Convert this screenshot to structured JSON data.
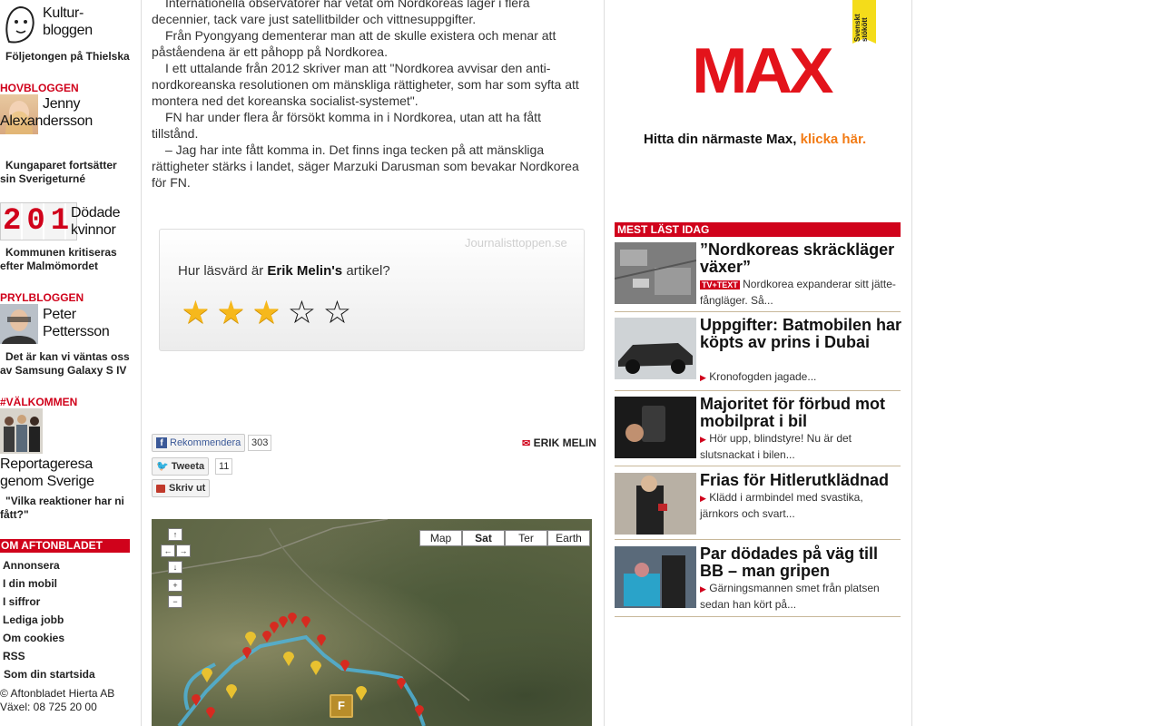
{
  "left": {
    "kultur": {
      "title": "Kultur-\nbloggen",
      "teaser": "Följetongen på Thielska"
    },
    "hovbloggen": {
      "label": "HOVBLOGGEN",
      "name": "Jenny\nAlexandersson",
      "teaser": "Kungaparet fortsätter\nsin Sverigeturné"
    },
    "counter": {
      "digits": "201",
      "title": "Dödade\nkvinnor",
      "teaser": "Kommunen kritiseras\nefter Malmömordet"
    },
    "prylbloggen": {
      "label": "PRYLBLOGGEN",
      "name": "Peter\nPettersson",
      "teaser": "Det är kan vi väntas oss\nav Samsung Galaxy S IV"
    },
    "valkommen": {
      "label": "#VÄLKOMMEN",
      "title": "Reportageresa\ngenom Sverige",
      "teaser": "\"Vilka reaktioner har ni\nfått?\""
    },
    "about": {
      "label": "OM AFTONBLADET",
      "items": [
        "Annonsera",
        "I din mobil",
        "I siffror",
        "Lediga jobb",
        "Om cookies",
        "RSS",
        "Som din startsida"
      ]
    },
    "footer": {
      "company": "© Aftonbladet Hierta AB",
      "phone": "Växel: 08 725 20 00"
    }
  },
  "article": {
    "paragraphs": [
      "Internationella observatörer har vetat om Nordkoreas läger i flera decennier, tack vare just satellitbilder och vittnesuppgifter.",
      "Från Pyongyang dementerar man att de skulle existera och menar att påståendena är ett påhopp på Nordkorea.",
      "I ett uttalande från 2012 skriver man att \"Nordkorea avvisar den anti-nordkoreanska resolutionen om mänskliga rättigheter, som har som syfta att montera ned det koreanska socialist-systemet\".",
      "FN har under flera år försökt komma in i Nordkorea, utan att ha fått tillstånd.",
      "– Jag har inte fått komma in. Det finns inga tecken på att mänskliga rättigheter stärks i landet, säger Marzuki Darusman som bevakar Nordkorea för FN."
    ],
    "rating": {
      "source": "Journalisttoppen.se",
      "question_prefix": "Hur läsvärd är",
      "author": "Erik Melin's",
      "question_suffix": "artikel?",
      "stars": 3,
      "max": 5
    },
    "social": {
      "recommend": "Rekommendera",
      "recommend_count": "303",
      "tweet": "Tweeta",
      "tweet_count": "11",
      "print": "Skriv ut"
    },
    "byline": "ERIK MELIN",
    "map": {
      "types": [
        "Map",
        "Sat",
        "Ter",
        "Earth"
      ],
      "active_type": "Sat",
      "marker_letter": "F"
    }
  },
  "right": {
    "ad": {
      "brand": "MAX",
      "ribbon": "Svenskt\nstökött",
      "text": "Hitta din närmaste Max,",
      "link": "klicka här.",
      "brand_color": "#e3131b",
      "link_color": "#f27b15"
    },
    "most_read_label": "MEST LÄST IDAG",
    "news": [
      {
        "title": "”Nordkoreas skräckläger växer”",
        "badge": "TV+TEXT",
        "teaser": "Nordkorea expanderar sitt jätte-fångläger. Så..."
      },
      {
        "title": "Uppgifter: Batmobilen har köpts av prins i Dubai",
        "teaser": "Kronofogden jagade..."
      },
      {
        "title": "Majoritet för förbud mot mobilprat i bil",
        "teaser": "Hör upp, blindstyre! Nu är det slutsnackat i bilen..."
      },
      {
        "title": "Frias för Hitlerutklädnad",
        "teaser": "Klädd i armbindel med svastika, järnkors och svart..."
      },
      {
        "title": "Par dödades på väg till BB – man gripen",
        "teaser": "Gärningsmannen smet från platsen sedan han kört på..."
      }
    ]
  }
}
